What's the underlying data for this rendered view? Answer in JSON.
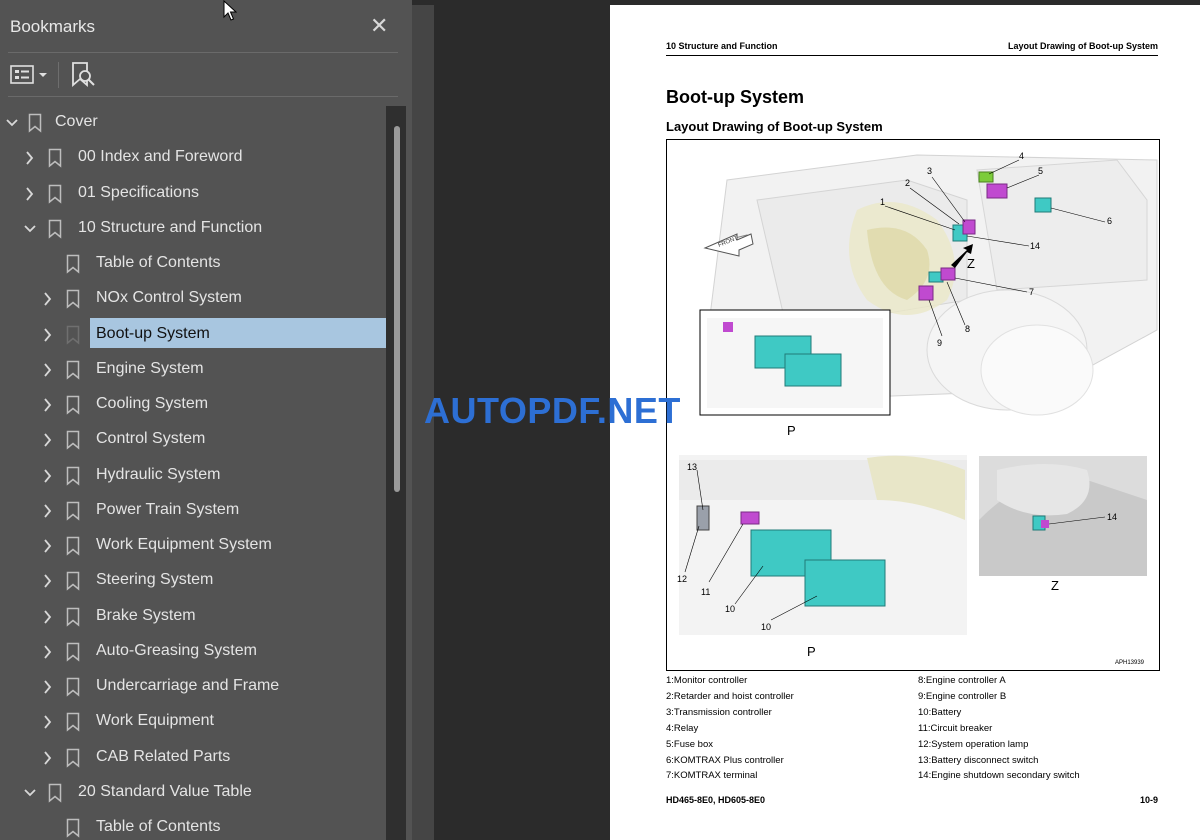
{
  "sidebar": {
    "title": "Bookmarks",
    "close_icon": "close-icon",
    "tools": {
      "options": "options-menu-icon",
      "find": "find-bookmark-icon"
    },
    "items": [
      {
        "label": "Cover",
        "level": 0,
        "expander": "expanded",
        "selected": false
      },
      {
        "label": "00 Index and Foreword",
        "level": 1,
        "expander": "collapsed",
        "selected": false
      },
      {
        "label": "01 Specifications",
        "level": 1,
        "expander": "collapsed",
        "selected": false
      },
      {
        "label": "10 Structure and Function",
        "level": 1,
        "expander": "expanded",
        "selected": false
      },
      {
        "label": "Table of Contents",
        "level": 2,
        "expander": "none",
        "selected": false
      },
      {
        "label": "NOx Control System",
        "level": 2,
        "expander": "collapsed",
        "selected": false
      },
      {
        "label": "Boot-up System",
        "level": 2,
        "expander": "collapsed",
        "selected": true
      },
      {
        "label": "Engine System",
        "level": 2,
        "expander": "collapsed",
        "selected": false
      },
      {
        "label": "Cooling System",
        "level": 2,
        "expander": "collapsed",
        "selected": false
      },
      {
        "label": "Control System",
        "level": 2,
        "expander": "collapsed",
        "selected": false
      },
      {
        "label": "Hydraulic System",
        "level": 2,
        "expander": "collapsed",
        "selected": false
      },
      {
        "label": "Power Train System",
        "level": 2,
        "expander": "collapsed",
        "selected": false
      },
      {
        "label": "Work Equipment System",
        "level": 2,
        "expander": "collapsed",
        "selected": false
      },
      {
        "label": "Steering System",
        "level": 2,
        "expander": "collapsed",
        "selected": false
      },
      {
        "label": "Brake System",
        "level": 2,
        "expander": "collapsed",
        "selected": false
      },
      {
        "label": "Auto-Greasing System",
        "level": 2,
        "expander": "collapsed",
        "selected": false
      },
      {
        "label": "Undercarriage and Frame",
        "level": 2,
        "expander": "collapsed",
        "selected": false
      },
      {
        "label": "Work Equipment",
        "level": 2,
        "expander": "collapsed",
        "selected": false
      },
      {
        "label": "CAB Related Parts",
        "level": 2,
        "expander": "collapsed",
        "selected": false
      },
      {
        "label": "20 Standard Value Table",
        "level": 1,
        "expander": "expanded",
        "selected": false
      },
      {
        "label": "Table of Contents",
        "level": 2,
        "expander": "none",
        "selected": false
      }
    ]
  },
  "document": {
    "header_left": "10 Structure and Function",
    "header_right": "Layout Drawing of Boot-up System",
    "title": "Boot-up System",
    "subtitle": "Layout Drawing of Boot-up System",
    "figure": {
      "view_labels": {
        "top_detail": "P",
        "bottom_detail": "P",
        "z_detail": "Z",
        "z_arrow": "Z",
        "front": "FRONT"
      },
      "callouts": [
        "1",
        "2",
        "3",
        "4",
        "5",
        "6",
        "7",
        "8",
        "9",
        "14",
        "13",
        "12",
        "11",
        "10",
        "10",
        "14"
      ],
      "code": "APH13939"
    },
    "legend_left": [
      "1:Monitor controller",
      "2:Retarder and hoist controller",
      "3:Transmission controller",
      "4:Relay",
      "5:Fuse box",
      "6:KOMTRAX Plus controller",
      "7:KOMTRAX terminal"
    ],
    "legend_right": [
      "8:Engine controller A",
      "9:Engine controller B",
      "10:Battery",
      "11:Circuit breaker",
      "12:System operation lamp",
      "13:Battery disconnect switch",
      "14:Engine shutdown secondary switch"
    ],
    "footer_left": "HD465-8E0, HD605-8E0",
    "footer_right": "10-9"
  },
  "watermark": "AUTOPDF.NET",
  "colors": {
    "selection": "#a8c6e0",
    "sidebar_bg": "#535353",
    "battery": "#3fc9c4",
    "controller": "#c04ad0",
    "relay": "#7ccc3a"
  }
}
